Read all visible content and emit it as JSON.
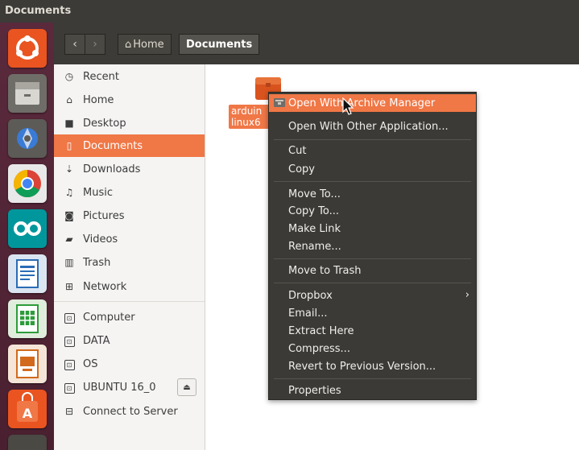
{
  "window": {
    "title": "Documents"
  },
  "launcher": {
    "items": [
      {
        "name": "ubuntu-dash-icon"
      },
      {
        "name": "files-icon"
      },
      {
        "name": "system-settings-icon"
      },
      {
        "name": "chrome-icon"
      },
      {
        "name": "arduino-icon"
      },
      {
        "name": "libreoffice-writer-icon"
      },
      {
        "name": "libreoffice-calc-icon"
      },
      {
        "name": "libreoffice-impress-icon"
      },
      {
        "name": "software-center-icon"
      }
    ]
  },
  "header": {
    "back": "‹",
    "forward": "›",
    "breadcrumb": {
      "home_label": "Home",
      "current_label": "Documents"
    }
  },
  "sidebar": {
    "places": [
      {
        "label": "Recent",
        "icon": "clock-icon",
        "glyph": "◷"
      },
      {
        "label": "Home",
        "icon": "home-icon",
        "glyph": "⌂"
      },
      {
        "label": "Desktop",
        "icon": "folder-icon",
        "glyph": "■"
      },
      {
        "label": "Documents",
        "icon": "document-icon",
        "glyph": "▯"
      },
      {
        "label": "Downloads",
        "icon": "download-icon",
        "glyph": "⇣"
      },
      {
        "label": "Music",
        "icon": "music-icon",
        "glyph": "♫"
      },
      {
        "label": "Pictures",
        "icon": "camera-icon",
        "glyph": "◙"
      },
      {
        "label": "Videos",
        "icon": "video-icon",
        "glyph": "▰"
      },
      {
        "label": "Trash",
        "icon": "trash-icon",
        "glyph": "▥"
      },
      {
        "label": "Network",
        "icon": "network-icon",
        "glyph": "⊞"
      }
    ],
    "devices": [
      {
        "label": "Computer"
      },
      {
        "label": "DATA"
      },
      {
        "label": "OS"
      },
      {
        "label": "UBUNTU 16_0"
      }
    ],
    "connect": {
      "label": "Connect to Server"
    }
  },
  "files": {
    "items": [
      {
        "label_line1": "arduin",
        "label_line2": "linux6"
      }
    ]
  },
  "context_menu": {
    "items": [
      {
        "label": "Open With Archive Manager",
        "highlighted": true
      },
      {
        "label": "Open With Other Application..."
      },
      {
        "label": "Cut"
      },
      {
        "label": "Copy"
      },
      {
        "label": "Move To..."
      },
      {
        "label": "Copy To..."
      },
      {
        "label": "Make Link"
      },
      {
        "label": "Rename..."
      },
      {
        "label": "Move to Trash"
      },
      {
        "label": "Dropbox",
        "submenu": "›"
      },
      {
        "label": "Email..."
      },
      {
        "label": "Extract Here"
      },
      {
        "label": "Compress..."
      },
      {
        "label": "Revert to Previous Version..."
      },
      {
        "label": "Properties"
      }
    ]
  },
  "colors": {
    "accent": "#f07746",
    "panel": "#3c3b37",
    "launcher": "#5a2a3c"
  }
}
